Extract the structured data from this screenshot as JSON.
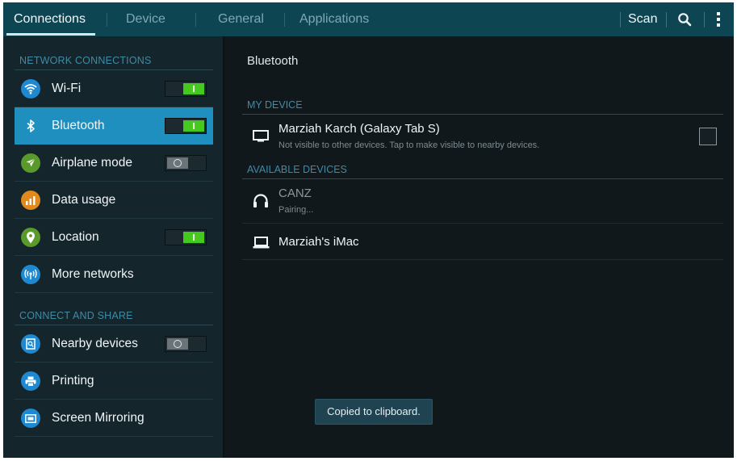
{
  "tabs": [
    {
      "label": "Connections",
      "active": true
    },
    {
      "label": "Device"
    },
    {
      "label": "General"
    },
    {
      "label": "Applications"
    }
  ],
  "actions": {
    "scan_label": "Scan",
    "search_icon": "search-icon",
    "more_icon": "more-vert-icon"
  },
  "sidebar": {
    "network_header": "NETWORK CONNECTIONS",
    "share_header": "CONNECT AND SHARE",
    "items": [
      {
        "label": "Wi-Fi",
        "icon": "wifi-icon",
        "icon_color": "#1e88d0",
        "toggle": "on"
      },
      {
        "label": "Bluetooth",
        "icon": "bluetooth-icon",
        "icon_color": "#1f8fbf",
        "toggle": "on",
        "selected": true
      },
      {
        "label": "Airplane mode",
        "icon": "airplane-icon",
        "icon_color": "#5a9a2a",
        "toggle": "off"
      },
      {
        "label": "Data usage",
        "icon": "data-usage-icon",
        "icon_color": "#e08a1e"
      },
      {
        "label": "Location",
        "icon": "location-icon",
        "icon_color": "#5a9a2a",
        "toggle": "on"
      },
      {
        "label": "More networks",
        "icon": "more-networks-icon",
        "icon_color": "#1e88d0"
      },
      {
        "label": "Nearby devices",
        "icon": "nearby-devices-icon",
        "icon_color": "#1e88d0",
        "toggle": "off"
      },
      {
        "label": "Printing",
        "icon": "printing-icon",
        "icon_color": "#1e88d0"
      },
      {
        "label": "Screen Mirroring",
        "icon": "screen-mirroring-icon",
        "icon_color": "#1e88d0"
      }
    ]
  },
  "main": {
    "title": "Bluetooth",
    "my_device_header": "MY DEVICE",
    "my_device": {
      "name": "Marziah Karch (Galaxy Tab S)",
      "subtitle": "Not visible to other devices. Tap to make visible to nearby devices.",
      "visible_checked": false
    },
    "available_header": "AVAILABLE DEVICES",
    "available": [
      {
        "name": "CANZ",
        "status": "Pairing...",
        "icon": "headphones-icon"
      },
      {
        "name": "Marziah's iMac",
        "icon": "laptop-icon"
      }
    ]
  },
  "toast": {
    "text": "Copied to clipboard."
  },
  "colors": {
    "topbar": "#0e4553",
    "accent": "#1f8fbf",
    "section_header": "#3f8ba6",
    "toggle_on": "#45c91e"
  }
}
